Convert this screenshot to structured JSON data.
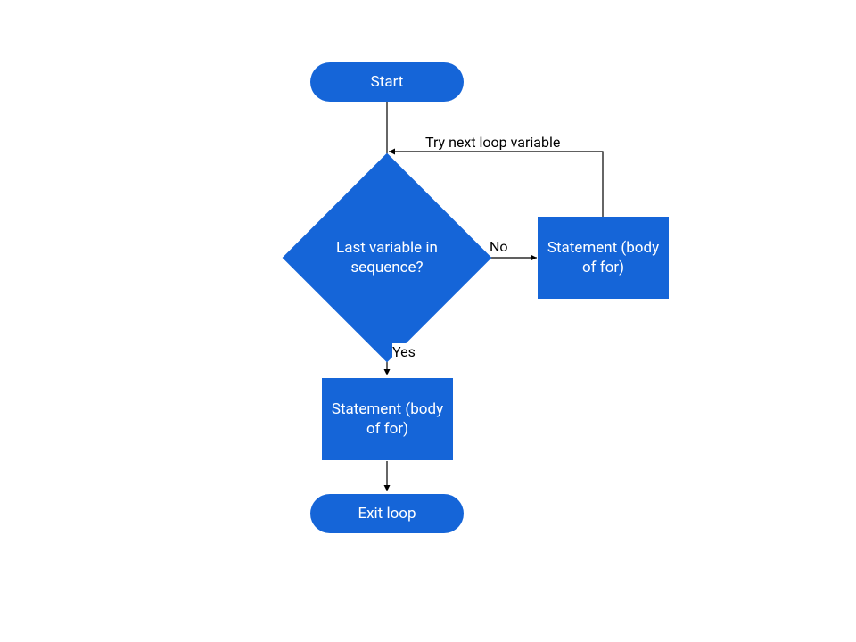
{
  "nodes": {
    "start": "Start",
    "decision": "Last variable in sequence?",
    "body_side": "Statement (body of for)",
    "body_below": "Statement (body of for)",
    "exit": "Exit loop"
  },
  "edges": {
    "no": "No",
    "yes": "Yes",
    "loopback": "Try next loop variable"
  },
  "colors": {
    "fill": "#1565d8",
    "stroke": "#000000"
  }
}
